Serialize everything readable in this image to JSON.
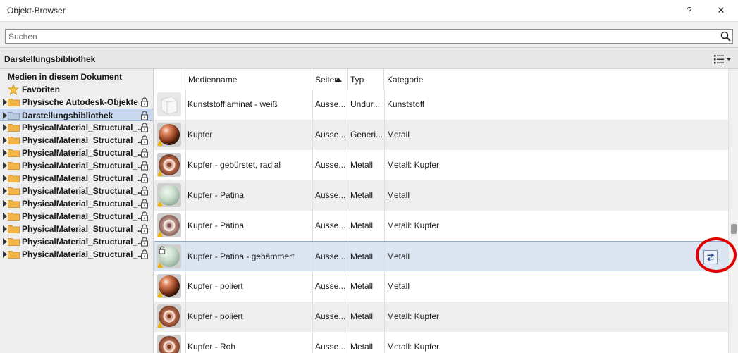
{
  "window": {
    "title": "Objekt-Browser",
    "help_label": "?",
    "close_label": "✕"
  },
  "search": {
    "placeholder": "Suchen",
    "value": ""
  },
  "library_header": {
    "title": "Darstellungsbibliothek",
    "view_icon": "list-view-icon"
  },
  "tree": {
    "top_items": [
      {
        "label": "Medien in diesem Dokument"
      },
      {
        "label": "Favoriten",
        "icon": "star-icon"
      }
    ],
    "items": [
      {
        "label": "Physische Autodesk-Objekte",
        "locked": true,
        "selected": false
      },
      {
        "label": "Darstellungsbibliothek",
        "locked": true,
        "selected": true
      },
      {
        "label": "PhysicalMaterial_Structural_...",
        "locked": true,
        "selected": false
      },
      {
        "label": "PhysicalMaterial_Structural_...",
        "locked": true,
        "selected": false
      },
      {
        "label": "PhysicalMaterial_Structural_...",
        "locked": true,
        "selected": false
      },
      {
        "label": "PhysicalMaterial_Structural_...",
        "locked": true,
        "selected": false
      },
      {
        "label": "PhysicalMaterial_Structural_...",
        "locked": true,
        "selected": false
      },
      {
        "label": "PhysicalMaterial_Structural_...",
        "locked": true,
        "selected": false
      },
      {
        "label": "PhysicalMaterial_Structural_...",
        "locked": true,
        "selected": false
      },
      {
        "label": "PhysicalMaterial_Structural_...",
        "locked": true,
        "selected": false
      },
      {
        "label": "PhysicalMaterial_Structural_...",
        "locked": true,
        "selected": false
      },
      {
        "label": "PhysicalMaterial_Structural_...",
        "locked": true,
        "selected": false
      },
      {
        "label": "PhysicalMaterial_Structural_...",
        "locked": true,
        "selected": false
      }
    ]
  },
  "table": {
    "columns": [
      "Medienname",
      "Seiten",
      "Typ",
      "Kategorie"
    ],
    "sort_column": "Medienname",
    "sort_direction": "ascending",
    "rows": [
      {
        "name": "Kunststofflaminat - weiß",
        "side": "Ausse...",
        "type": "Undur...",
        "category": "Kunststoff",
        "thumb": "white-cube",
        "warn": false,
        "locked": false,
        "selected": false
      },
      {
        "name": "Kupfer",
        "side": "Ausse...",
        "type": "Generi...",
        "category": "Metall",
        "thumb": "copper-sphere",
        "warn": true,
        "locked": false,
        "selected": false
      },
      {
        "name": "Kupfer - gebürstet, radial",
        "side": "Ausse...",
        "type": "Metall",
        "category": "Metall: Kupfer",
        "thumb": "copper-ring",
        "warn": true,
        "locked": false,
        "selected": false
      },
      {
        "name": "Kupfer - Patina",
        "side": "Ausse...",
        "type": "Metall",
        "category": "Metall",
        "thumb": "patina-sphere",
        "warn": true,
        "locked": false,
        "selected": false
      },
      {
        "name": "Kupfer - Patina",
        "side": "Ausse...",
        "type": "Metall",
        "category": "Metall: Kupfer",
        "thumb": "patina-ring",
        "warn": true,
        "locked": false,
        "selected": false
      },
      {
        "name": "Kupfer - Patina - gehämmert",
        "side": "Ausse...",
        "type": "Metall",
        "category": "Metall",
        "thumb": "patina-sphere",
        "warn": true,
        "locked": true,
        "selected": true
      },
      {
        "name": "Kupfer - poliert",
        "side": "Ausse...",
        "type": "Metall",
        "category": "Metall",
        "thumb": "copper-sphere",
        "warn": true,
        "locked": false,
        "selected": false
      },
      {
        "name": "Kupfer - poliert",
        "side": "Ausse...",
        "type": "Metall",
        "category": "Metall: Kupfer",
        "thumb": "copper-ring",
        "warn": true,
        "locked": false,
        "selected": false
      },
      {
        "name": "Kupfer - Roh",
        "side": "Ausse...",
        "type": "Metall",
        "category": "Metall: Kupfer",
        "thumb": "copper-ring",
        "warn": false,
        "locked": false,
        "selected": false
      }
    ],
    "selected_row_action_icon": "replace-material-icon"
  },
  "colors": {
    "selection": "#dce6f3",
    "highlight_circle": "#e00000",
    "folder": "#f4b548",
    "warning": "#f2b100"
  }
}
